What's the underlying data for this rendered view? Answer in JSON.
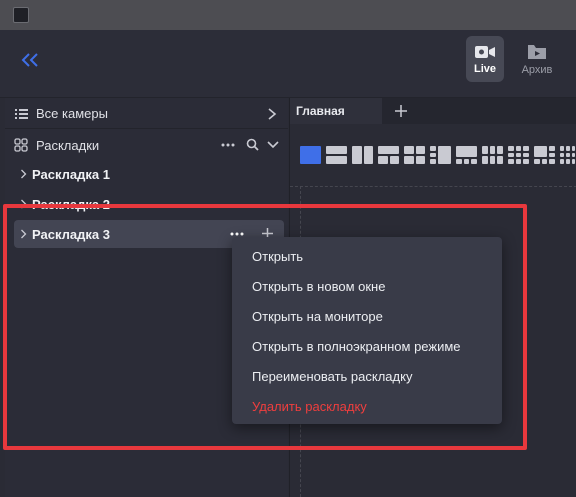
{
  "topbar": {
    "live_label": "Live",
    "archive_label": "Архив",
    "accent": "#3f6fe8"
  },
  "sidebar": {
    "all_cameras_label": "Все камеры",
    "layouts_label": "Раскладки",
    "layouts": [
      {
        "label": "Раскладка 1",
        "selected": false
      },
      {
        "label": "Раскладка 2",
        "selected": false
      },
      {
        "label": "Раскладка 3",
        "selected": true
      }
    ]
  },
  "workspace": {
    "tabs": [
      {
        "label": "Главная",
        "active": true
      }
    ],
    "add_tab_icon": "plus-icon",
    "grid_layouts_count_visible": 12,
    "active_grid_layout": 0
  },
  "context_menu": {
    "items": [
      {
        "label": "Открыть"
      },
      {
        "label": "Открыть в новом окне"
      },
      {
        "label": "Открыть на мониторе"
      },
      {
        "label": "Открыть в полноэкранном режиме"
      },
      {
        "label": "Переименовать раскладку"
      },
      {
        "label": "Удалить раскладку",
        "danger": true
      }
    ],
    "danger_color": "#ef3e3e"
  },
  "annotation": {
    "highlight_color": "#e8383d"
  }
}
